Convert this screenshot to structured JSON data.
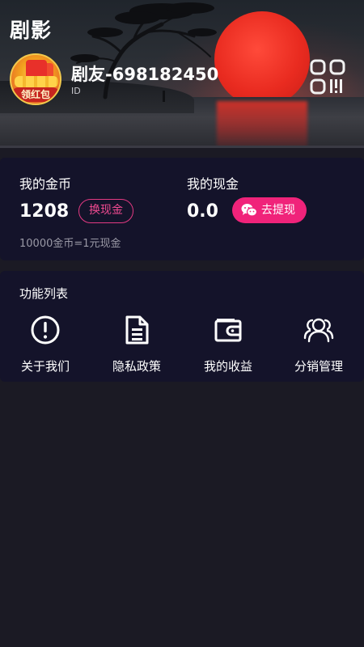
{
  "app": {
    "title": "剧影"
  },
  "profile": {
    "nickname": "剧友-698182450",
    "id_text": "ID",
    "avatar_badge": "领红包"
  },
  "wallet": {
    "coins_label": "我的金币",
    "coins_value": "1208",
    "exchange_button": "换现金",
    "cash_label": "我的现金",
    "cash_value": "0.0",
    "withdraw_button": "去提现",
    "rate_note": "10000金币=1元现金"
  },
  "functions": {
    "title": "功能列表",
    "items": [
      {
        "label": "关于我们",
        "icon": "info-icon"
      },
      {
        "label": "隐私政策",
        "icon": "document-icon"
      },
      {
        "label": "我的收益",
        "icon": "wallet-icon"
      },
      {
        "label": "分销管理",
        "icon": "users-icon"
      }
    ]
  },
  "colors": {
    "background": "#1b1a24",
    "card": "#14132a",
    "accent_pink": "#f0237a",
    "outline_pink": "#e33a82"
  }
}
